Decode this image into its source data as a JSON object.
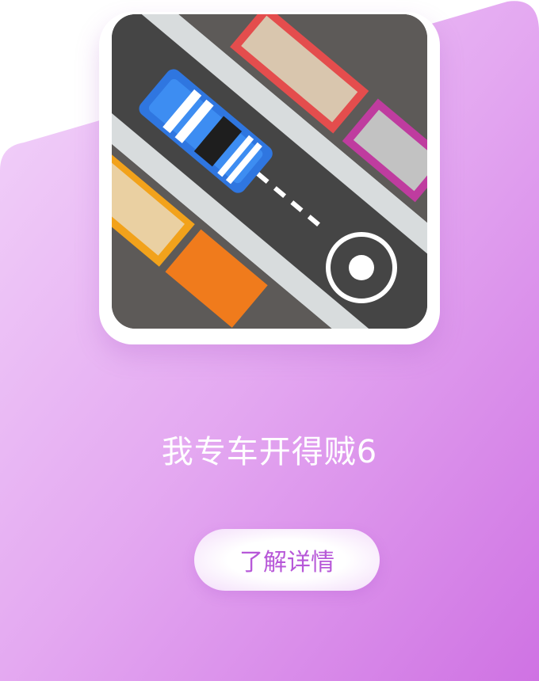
{
  "game": {
    "title": "我专车开得贼6",
    "icon_name": "car-driving-game-icon"
  },
  "cta": {
    "label": "了解详情"
  },
  "colors": {
    "gradient_start": "#f0ccf7",
    "gradient_end": "#cf75e4",
    "button_text": "#b758d8",
    "title_text": "#ffffff"
  }
}
